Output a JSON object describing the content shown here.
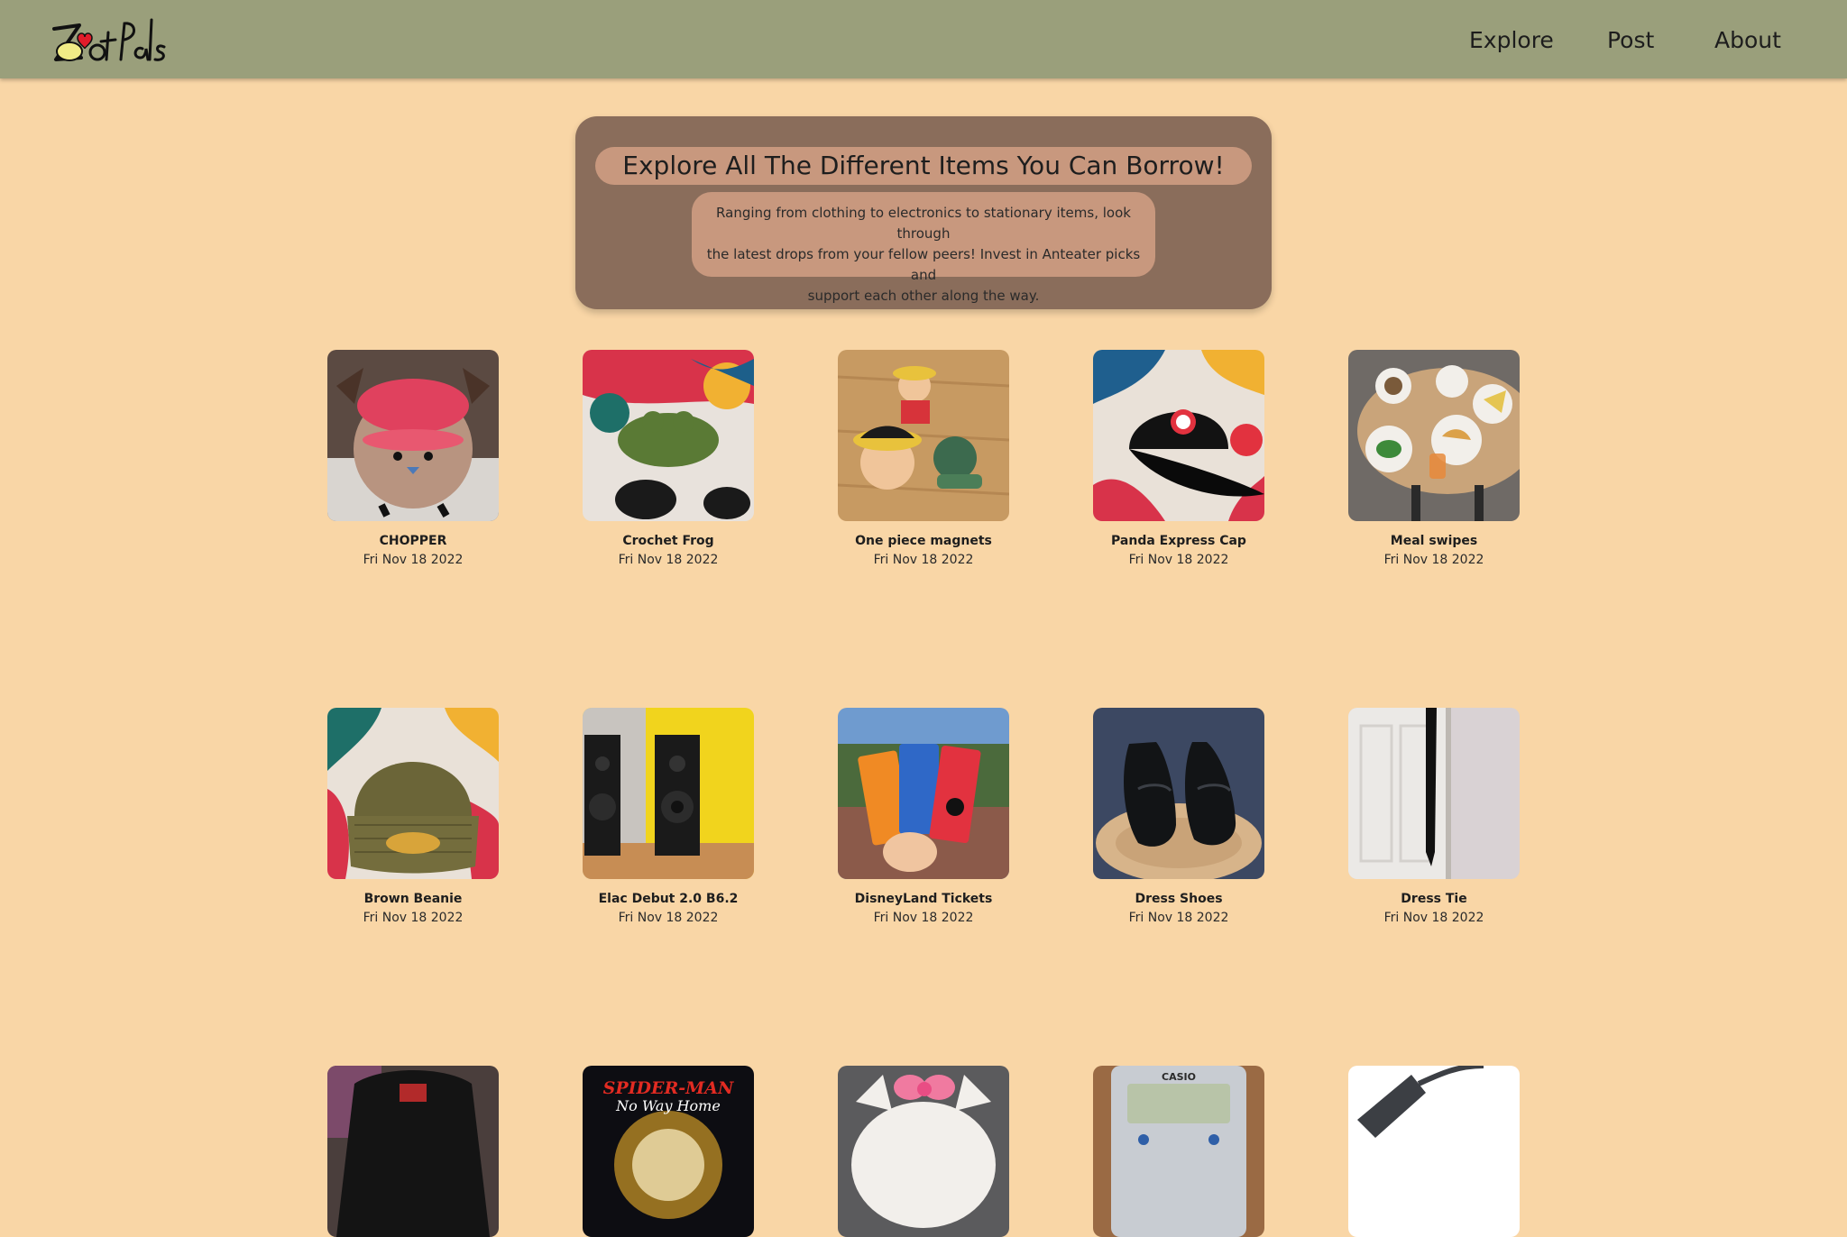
{
  "brand": {
    "logo_text": "ZotPals",
    "accent": "#e11c2a"
  },
  "nav": {
    "links": [
      {
        "label": "Explore"
      },
      {
        "label": "Post"
      },
      {
        "label": "About"
      }
    ]
  },
  "hero": {
    "title": "Explore All The Different Items You Can Borrow!",
    "description_lines": [
      "Ranging from clothing to electronics to stationary items, look through",
      "the latest drops from your fellow peers! Invest in Anteater picks and",
      "support each other along the way."
    ]
  },
  "items": [
    {
      "name": "CHOPPER",
      "date": "Fri Nov 18 2022",
      "image": "chopper-plush-photo"
    },
    {
      "name": "Crochet Frog",
      "date": "Fri Nov 18 2022",
      "image": "crochet-frog-photo"
    },
    {
      "name": "One piece magnets",
      "date": "Fri Nov 18 2022",
      "image": "one-piece-magnets-photo"
    },
    {
      "name": "Panda Express Cap",
      "date": "Fri Nov 18 2022",
      "image": "black-cap-photo"
    },
    {
      "name": "Meal swipes",
      "date": "Fri Nov 18 2022",
      "image": "meal-plates-photo"
    },
    {
      "name": "Brown Beanie",
      "date": "Fri Nov 18 2022",
      "image": "beanie-photo"
    },
    {
      "name": "Elac Debut 2.0 B6.2",
      "date": "Fri Nov 18 2022",
      "image": "speakers-photo"
    },
    {
      "name": "DisneyLand Tickets",
      "date": "Fri Nov 18 2022",
      "image": "disney-tickets-photo"
    },
    {
      "name": "Dress Shoes",
      "date": "Fri Nov 18 2022",
      "image": "dress-shoes-photo"
    },
    {
      "name": "Dress Tie",
      "date": "Fri Nov 18 2022",
      "image": "dress-tie-photo"
    },
    {
      "image": "bag-photo"
    },
    {
      "image": "spider-man-poster-photo",
      "image_text": [
        "SPIDER-MAN",
        "No Way Home"
      ]
    },
    {
      "image": "hello-kitty-plush-photo"
    },
    {
      "image": "calculator-photo",
      "image_text": [
        "CASIO"
      ]
    },
    {
      "image": "desk-lamp-photo"
    }
  ]
}
